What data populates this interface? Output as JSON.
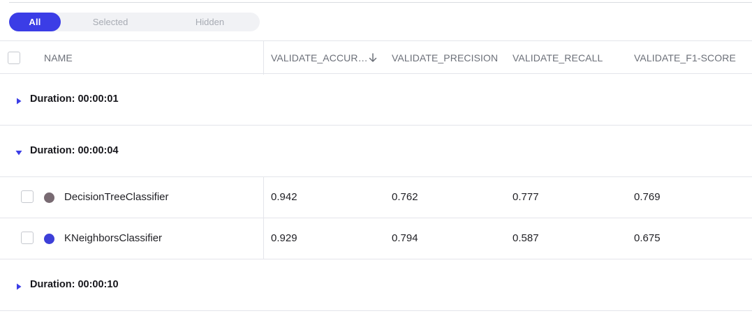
{
  "filter_tabs": [
    {
      "label": "All",
      "active": true
    },
    {
      "label": "Selected",
      "active": false
    },
    {
      "label": "Hidden",
      "active": false
    }
  ],
  "columns": {
    "name": "NAME",
    "accuracy": "VALIDATE_ACCUR…",
    "precision": "VALIDATE_PRECISION",
    "recall": "VALIDATE_RECALL",
    "f1": "VALIDATE_F1-SCORE"
  },
  "sort_icon": "arrow-down-icon",
  "groups": [
    {
      "label": "Duration: 00:00:01",
      "expanded": false
    },
    {
      "label": "Duration: 00:00:04",
      "expanded": true
    },
    {
      "label": "Duration: 00:00:10",
      "expanded": false
    }
  ],
  "rows": [
    {
      "name": "DecisionTreeClassifier",
      "color": "#786a72",
      "accuracy": "0.942",
      "precision": "0.762",
      "recall": "0.777",
      "f1": "0.769"
    },
    {
      "name": "KNeighborsClassifier",
      "color": "#3d3fd8",
      "accuracy": "0.929",
      "precision": "0.794",
      "recall": "0.587",
      "f1": "0.675"
    }
  ],
  "colors": {
    "accent": "#3b3de6",
    "border": "#e3e5ea"
  }
}
